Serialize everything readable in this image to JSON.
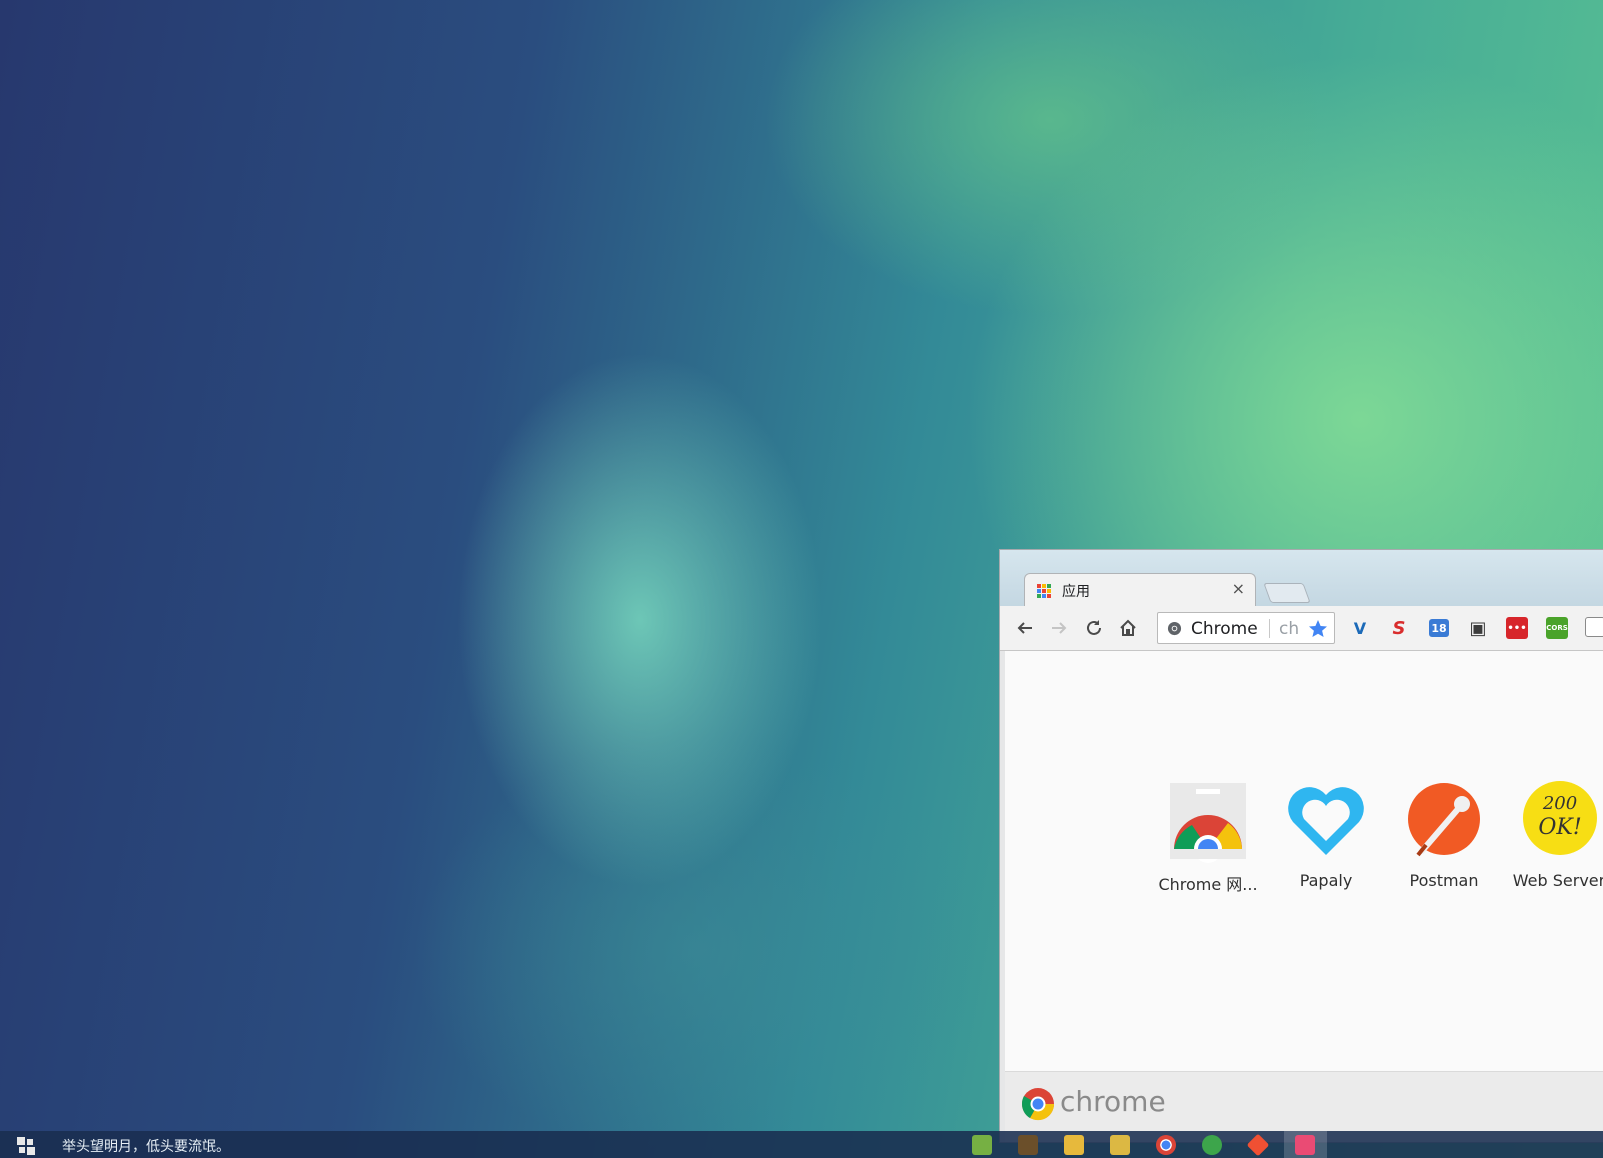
{
  "browser": {
    "tab": {
      "title": "应用",
      "close_glyph": "×"
    },
    "omnibox": {
      "chip_label": "Chrome",
      "url_text": "ch"
    },
    "toolbar_icons": [
      "back-icon",
      "forward-icon",
      "reload-icon",
      "home-icon",
      "bookmark-star-icon"
    ],
    "extensions": [
      {
        "name": "vue-devtools-icon",
        "glyph": "V",
        "color": "#1c6ab8"
      },
      {
        "name": "s-extension-icon",
        "glyph": "S",
        "color": "#d92d2d"
      },
      {
        "name": "calendar-extension-icon",
        "glyph": "18",
        "color": "#3a7bd5"
      },
      {
        "name": "qr-code-icon",
        "glyph": "▣",
        "color": "#3c3c3c"
      },
      {
        "name": "red-dots-extension-icon",
        "glyph": "•••",
        "color": "#d7262b"
      },
      {
        "name": "cors-extension-icon",
        "glyph": "CORS",
        "color": "#4aa32a"
      }
    ],
    "apps": [
      {
        "name": "app-chrome-web-store",
        "label": "Chrome 网..."
      },
      {
        "name": "app-papaly",
        "label": "Papaly"
      },
      {
        "name": "app-postman",
        "label": "Postman"
      },
      {
        "name": "app-web-server",
        "label": "Web Server",
        "icon_text_line1": "200",
        "icon_text_line2": "OK!"
      }
    ],
    "footer_brand": "chrome"
  },
  "taskbar": {
    "status_text": "举头望明月，低头要流氓。",
    "tray_icons": [
      {
        "name": "notepad-plus-icon",
        "color": "#76b043"
      },
      {
        "name": "sublime-text-icon",
        "color": "#6b4f2a"
      },
      {
        "name": "file-explorer-icon",
        "color": "#e7b93c"
      },
      {
        "name": "help-document-icon",
        "color": "#dcb843"
      },
      {
        "name": "chrome-taskbar-icon",
        "color": "#db4437"
      },
      {
        "name": "hbuilder-icon",
        "color": "#3da54b"
      },
      {
        "name": "git-icon",
        "color": "#f05033"
      },
      {
        "name": "screen-recorder-icon",
        "color": "#ea4b74"
      }
    ]
  }
}
